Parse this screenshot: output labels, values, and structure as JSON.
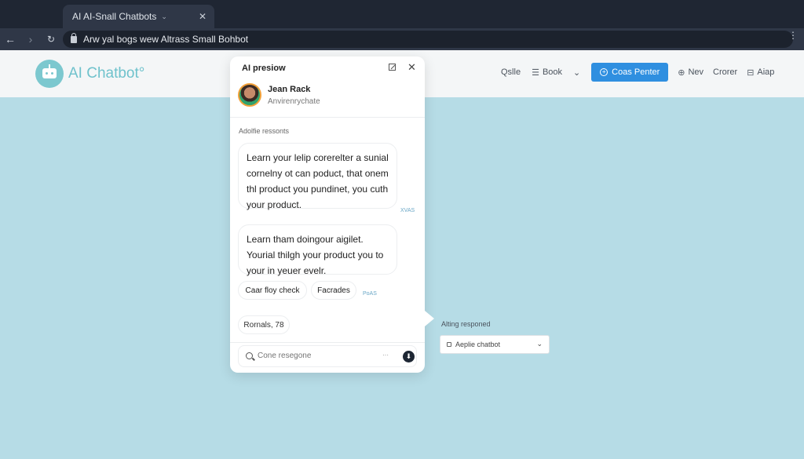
{
  "browser": {
    "tab_title": "AI AI-Snall Chatbots",
    "tab_chevron": "⌄",
    "tab_close": "✕",
    "back": "←",
    "forward": "›",
    "reload": "↻",
    "url": "Arw yal bogs wew Altrass Small Bohbot",
    "menu": "⋮"
  },
  "site": {
    "logo_text": "AI Chatbot°",
    "nav": [
      {
        "label": "Qslle",
        "icon": ""
      },
      {
        "label": "Book",
        "icon": "☰"
      },
      {
        "label": "⌄",
        "icon": ""
      },
      {
        "label": "Coas Penter",
        "icon": "+"
      },
      {
        "label": "Nev",
        "icon": "⊕"
      },
      {
        "label": "Crorer",
        "icon": ""
      },
      {
        "label": "Aiap",
        "icon": "⊟"
      }
    ]
  },
  "chat": {
    "title": "AI presiow",
    "close": "✕",
    "agent_name": "Jean Rack",
    "agent_status": "Anvirenrychate",
    "section_label": "Adolfie ressonts",
    "messages": [
      {
        "text": "Learn your lelip corerelter a sunial cornelny ot can poduct, that onem thl product you pundinet, you cuth your product.",
        "time": "XVAS"
      },
      {
        "text": "Learn tham doingour aigilet. Yourial thilgh your product you to your in yeuer evelr.",
        "time": "PoAS"
      }
    ],
    "chips": [
      "Caar floy check",
      "Facrades"
    ],
    "note_chip": "Rornals, 78",
    "input_placeholder": "Cone resegone",
    "more": "···",
    "send": "⬇"
  },
  "side_panel": {
    "label": "Alting responed",
    "select_value": "Aeplie chatbot",
    "chevron": "⌄"
  },
  "colors": {
    "background": "#b6dce6",
    "brand": "#6fc2cc",
    "cta": "#2f8fe0",
    "chrome_dark": "#1f2633"
  }
}
